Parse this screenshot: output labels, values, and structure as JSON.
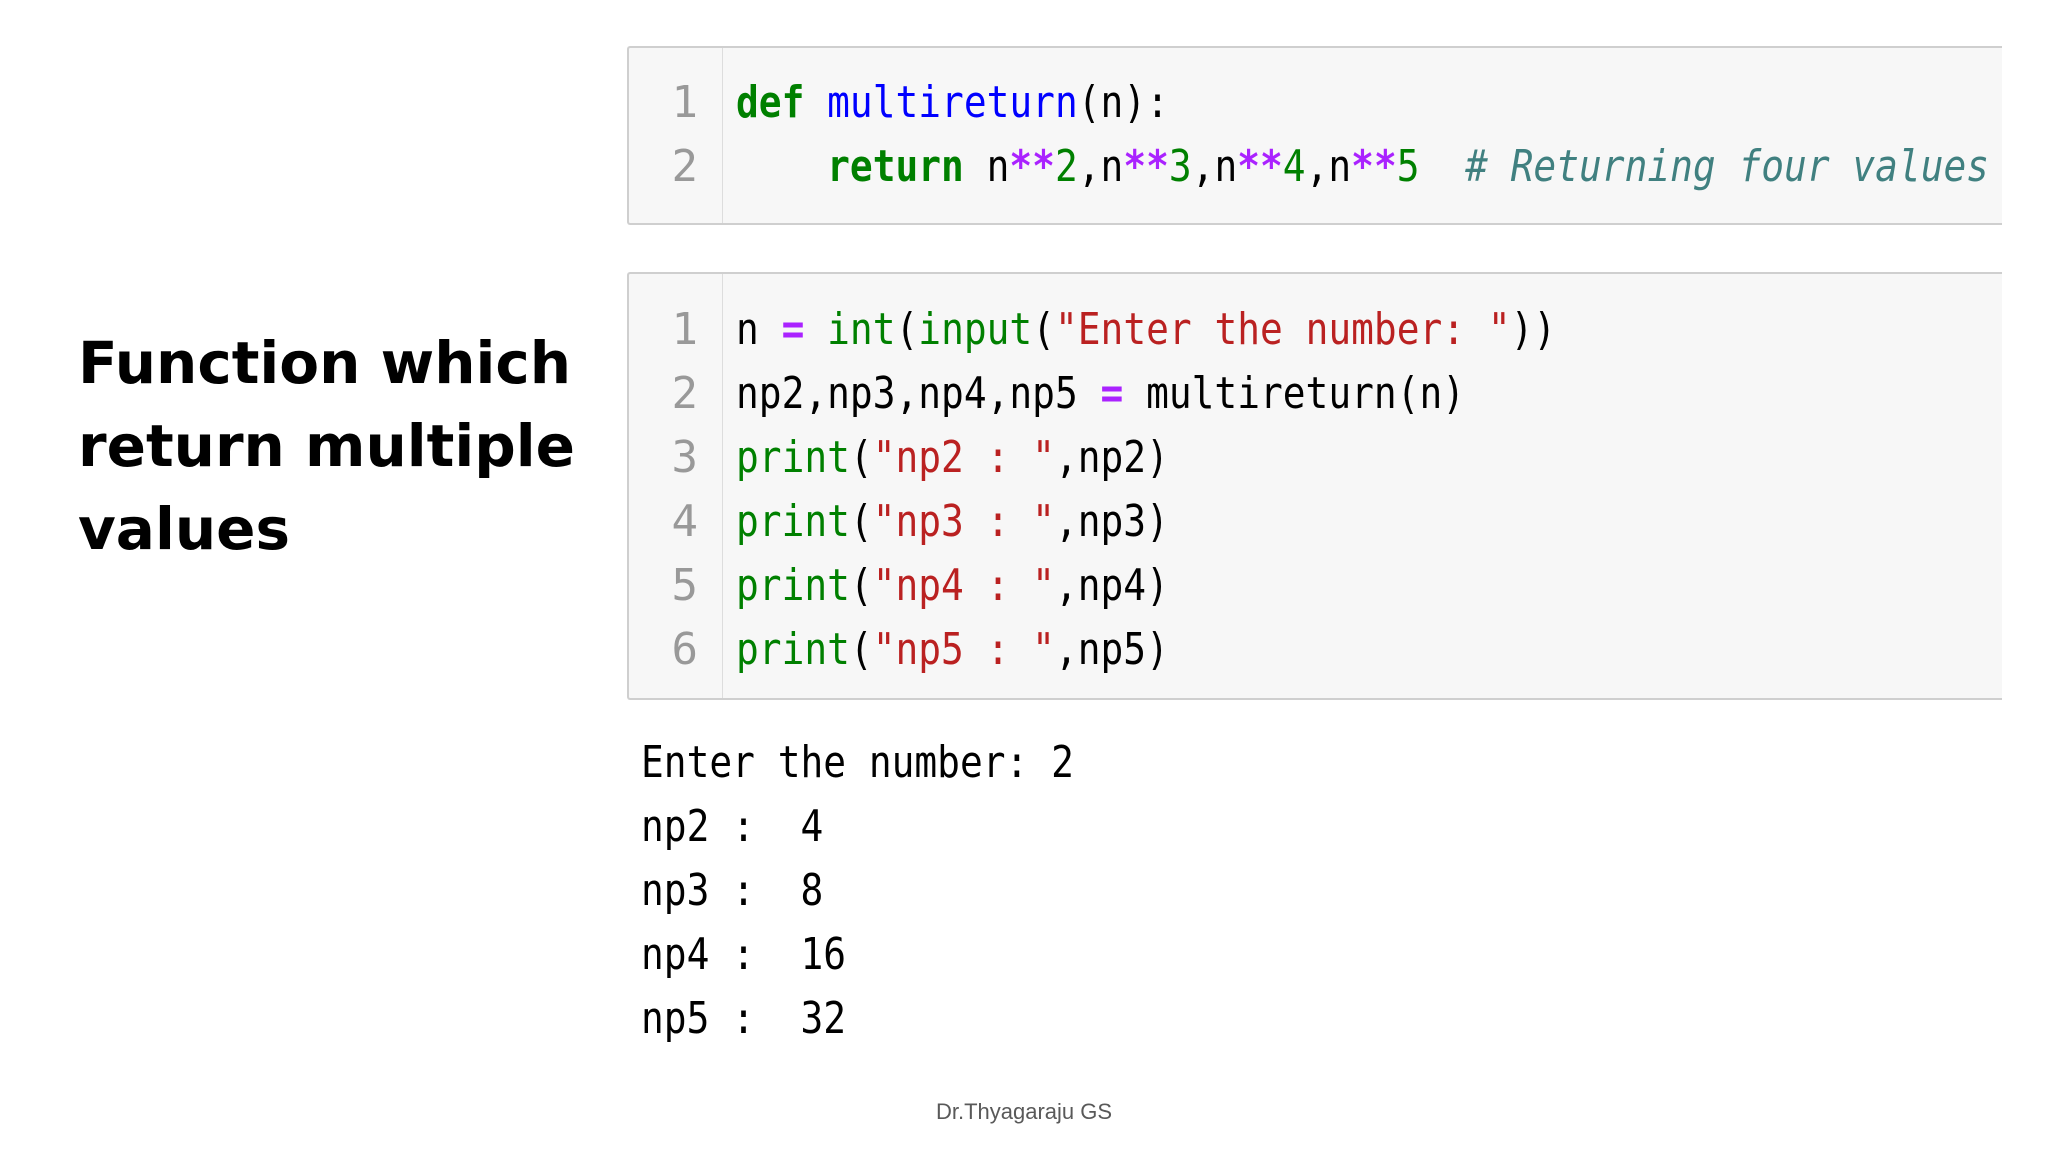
{
  "title": {
    "line1": "Function which",
    "line2": "return multiple",
    "line3": "values"
  },
  "cell1": {
    "line_numbers": [
      "1",
      "2"
    ],
    "line1": {
      "kw_def": "def",
      "space1": " ",
      "fn_name": "multireturn",
      "rest": "(n):"
    },
    "line2": {
      "indent": "    ",
      "kw_return": "return",
      "p1": " n",
      "op1": "**",
      "n1": "2",
      "c1": ",n",
      "op2": "**",
      "n2": "3",
      "c2": ",n",
      "op3": "**",
      "n3": "4",
      "c3": ",n",
      "op4": "**",
      "n4": "5",
      "gap": "  ",
      "comment": "# Returning four values"
    }
  },
  "cell2": {
    "line_numbers": [
      "1",
      "2",
      "3",
      "4",
      "5",
      "6"
    ],
    "line1": {
      "a": "n ",
      "op": "=",
      "b": " ",
      "int": "int",
      "c": "(",
      "input": "input",
      "d": "(",
      "str": "\"Enter the number: \"",
      "e": "))"
    },
    "line2": {
      "a": "np2,np3,np4,np5 ",
      "op": "=",
      "b": " multireturn(n)"
    },
    "line3": {
      "print": "print",
      "a": "(",
      "str": "\"np2 : \"",
      "b": ",np2)"
    },
    "line4": {
      "print": "print",
      "a": "(",
      "str": "\"np3 : \"",
      "b": ",np3)"
    },
    "line5": {
      "print": "print",
      "a": "(",
      "str": "\"np4 : \"",
      "b": ",np4)"
    },
    "line6": {
      "print": "print",
      "a": "(",
      "str": "\"np5 : \"",
      "b": ",np5)"
    }
  },
  "output": [
    "Enter the number: 2",
    "np2 :  4",
    "np3 :  8",
    "np4 :  16",
    "np5 :  32"
  ],
  "footer": "Dr.Thyagaraju GS"
}
